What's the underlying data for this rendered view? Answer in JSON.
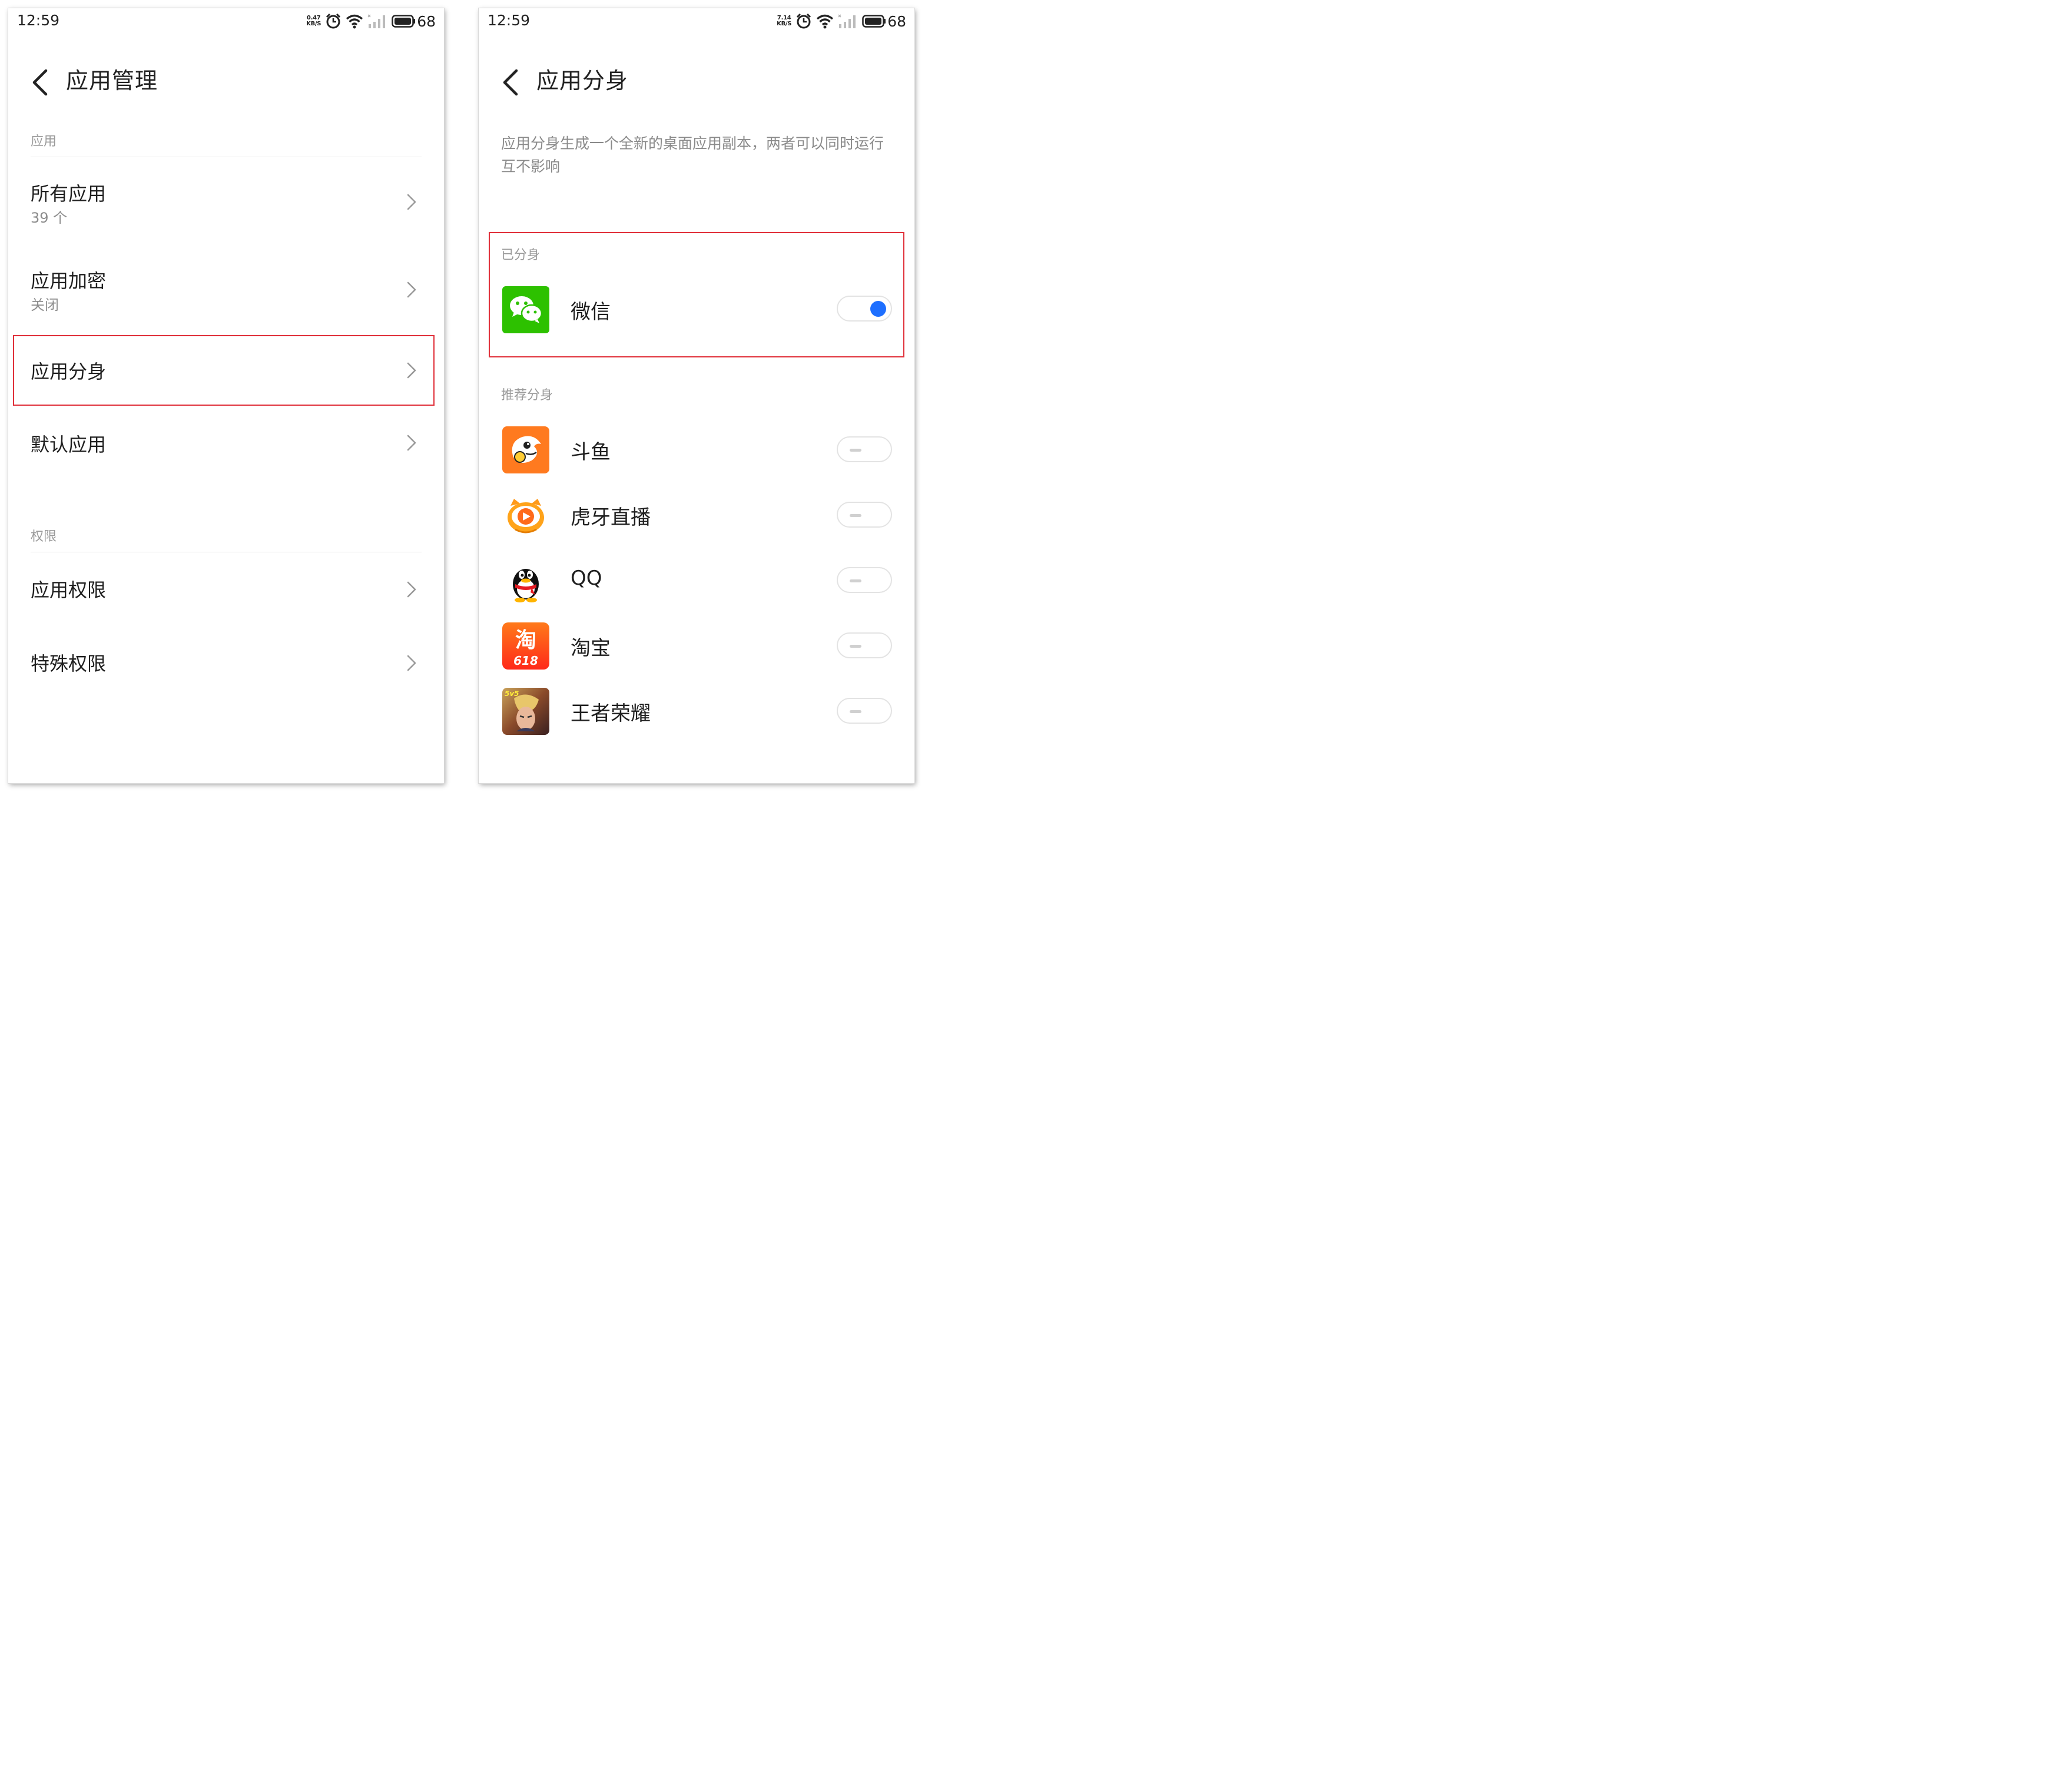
{
  "left": {
    "status": {
      "time": "12:59",
      "speed_value": "0.47",
      "speed_unit": "KB/S",
      "battery": "68"
    },
    "header": {
      "title": "应用管理"
    },
    "sections": [
      {
        "label": "应用",
        "items": [
          {
            "label": "所有应用",
            "sub": "39 个"
          },
          {
            "label": "应用加密",
            "sub": "关闭"
          },
          {
            "label": "应用分身",
            "highlighted": true
          },
          {
            "label": "默认应用"
          }
        ]
      },
      {
        "label": "权限",
        "items": [
          {
            "label": "应用权限"
          },
          {
            "label": "特殊权限"
          }
        ]
      }
    ]
  },
  "right": {
    "status": {
      "time": "12:59",
      "speed_value": "7.14",
      "speed_unit": "KB/S",
      "battery": "68"
    },
    "header": {
      "title": "应用分身"
    },
    "description": "应用分身生成一个全新的桌面应用副本，两者可以同时运行互不影响",
    "cloned": {
      "label": "已分身",
      "items": [
        {
          "name": "微信",
          "icon": "wechat-icon",
          "enabled": true
        }
      ]
    },
    "recommended": {
      "label": "推荐分身",
      "items": [
        {
          "name": "斗鱼",
          "icon": "douyu-icon",
          "enabled": false
        },
        {
          "name": "虎牙直播",
          "icon": "huya-icon",
          "enabled": false
        },
        {
          "name": "QQ",
          "icon": "qq-icon",
          "enabled": false
        },
        {
          "name": "淘宝",
          "icon": "taobao-icon",
          "enabled": false,
          "icon_text": "淘",
          "icon_badge": "618"
        },
        {
          "name": "王者荣耀",
          "icon": "honor-of-kings-icon",
          "enabled": false,
          "icon_badge": "5v5"
        }
      ]
    }
  },
  "colors": {
    "highlight": "#e0303a",
    "toggle_on": "#1e6fff",
    "secondary_text": "#8e8e8e"
  }
}
